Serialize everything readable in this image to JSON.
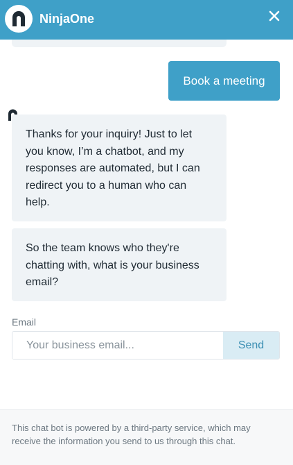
{
  "header": {
    "title": "NinjaOne",
    "close_icon": "close-icon",
    "brand_color": "#3fa0c8"
  },
  "messages": {
    "book_meeting_label": "Book a meeting",
    "bot_message_1": "Thanks for your inquiry! Just to let you know, I’m a chatbot, and my responses are automated, but I can redirect you to a human who can help.",
    "bot_message_2": "So the team knows who they're chatting with, what is your business email?"
  },
  "email_form": {
    "label": "Email",
    "placeholder": "Your business email...",
    "value": "",
    "send_label": "Send"
  },
  "footer": {
    "disclaimer": "This chat bot is powered by a third-party service, which may receive the information you send to us through this chat."
  }
}
